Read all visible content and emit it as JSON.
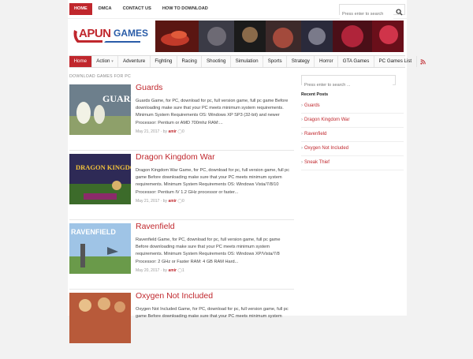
{
  "topnav": {
    "items": [
      {
        "label": "HOME"
      },
      {
        "label": "DMCA"
      },
      {
        "label": "CONTACT US"
      },
      {
        "label": "HOW TO DOWNLOAD"
      }
    ],
    "search_placeholder": "Press enter to search"
  },
  "logo": {
    "part1": "APUN",
    "part2": "GAMES"
  },
  "mainnav": {
    "items": [
      {
        "label": "Home"
      },
      {
        "label": "Action"
      },
      {
        "label": "Adventure"
      },
      {
        "label": "Fighting"
      },
      {
        "label": "Racing"
      },
      {
        "label": "Shooting"
      },
      {
        "label": "Simulation"
      },
      {
        "label": "Sports"
      },
      {
        "label": "Strategy"
      },
      {
        "label": "Horror"
      },
      {
        "label": "GTA Games"
      },
      {
        "label": "PC Games List"
      }
    ]
  },
  "main": {
    "section_title": "DOWNLOAD GAMES FOR PC",
    "posts": [
      {
        "title": "Guards",
        "excerpt": "Guards Game, for PC, download for pc, full version game, full pc game Before downloading make sure that your PC meets minimum system requirements. Minimum System Requirements OS: Windows XP SP3 (32-bit) and newer Processor: Pentium or AMD 700mhz RAM:...",
        "date": "May 21, 2017",
        "by": "by",
        "author": "amir",
        "comments": "0",
        "thumb_text": "GUARDS"
      },
      {
        "title": "Dragon Kingdom War",
        "excerpt": "Dragon Kingdom War Game, for PC, download for pc, full version game, full pc game Before downloading make sure that your PC meets minimum system requirements. Minimum System Requirements OS: Windows Vista/7/8/10 Processor: Pentium IV 1.2 GHz processor or faster...",
        "date": "May 21, 2017",
        "by": "by",
        "author": "amir",
        "comments": "0",
        "thumb_text": "DRAGON KINGDOM WAR"
      },
      {
        "title": "Ravenfield",
        "excerpt": "Ravenfield Game, for PC, download for pc, full version game, full pc game Before downloading make sure that your PC meets minimum system requirements. Minimum System Requirements OS: Windows XP/Vista/7/8 Processor: 2 GHz or Faster RAM: 4 GB RAM Hard...",
        "date": "May 20, 2017",
        "by": "by",
        "author": "amir",
        "comments": "1",
        "thumb_text": "RAVENFIELD"
      },
      {
        "title": "Oxygen Not Included",
        "excerpt": "Oxygen Not Included Game, for PC, download for pc, full version game, full pc game Before downloading make sure that your PC meets minimum system",
        "date": "",
        "by": "",
        "author": "",
        "comments": "",
        "thumb_text": ""
      }
    ]
  },
  "sidebar": {
    "search_placeholder": "Press enter to search ...",
    "recent_title": "Recent Posts",
    "recent": [
      {
        "label": "Guards"
      },
      {
        "label": "Dragon Kingdom War"
      },
      {
        "label": "Ravenfield"
      },
      {
        "label": "Oxygen Not Included"
      },
      {
        "label": "Sneak Thief"
      }
    ]
  },
  "colors": {
    "accent": "#c0272d",
    "link_blue": "#2a5ca8"
  },
  "icons": {
    "search": "search-icon",
    "rss": "rss-icon",
    "comment": "comment-icon",
    "dropdown": "chevron-down-icon"
  }
}
